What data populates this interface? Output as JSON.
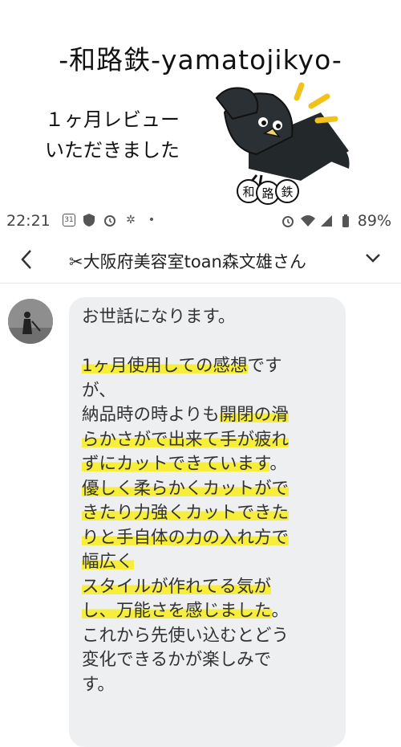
{
  "banner": {
    "brand": "-和路鉄-yamatojikyo-",
    "caption_line1": "１ヶ月レビュー",
    "caption_line2": "いただきました",
    "mascot_label": "和路鉄"
  },
  "status_bar": {
    "time": "22:21",
    "calendar_day": "31",
    "battery_percent": "89%",
    "icons_left": [
      "calendar-icon",
      "shield-icon",
      "alarm-icon",
      "fan-icon",
      "dot-icon"
    ],
    "icons_right": [
      "alarm-icon",
      "wifi-icon",
      "signal-icon",
      "battery-icon"
    ]
  },
  "chat_header": {
    "title": "✂大阪府美容室toan森文雄さん",
    "back_icon": "chevron-left-icon",
    "menu_icon": "chevron-down-icon"
  },
  "message": {
    "segments": [
      {
        "t": "お世話になります。\n\n",
        "h": false
      },
      {
        "t": "1ヶ月使用しての感想",
        "h": true
      },
      {
        "t": "です\nが、\n納品時の時よりも",
        "h": false
      },
      {
        "t": "開閉の滑\nらかさがで出来て手が疲れ\nずにカットできています",
        "h": true
      },
      {
        "t": "。\n",
        "h": false
      },
      {
        "t": "優しく柔らかくカットがで\nきたり力強くカットできた\nりと手自体の力の入れ方で\n幅広く",
        "h": true
      },
      {
        "t": "\n",
        "h": false
      },
      {
        "t": "スタイルが作れてる気が\nし、万能さを感じました",
        "h": true
      },
      {
        "t": "。\nこれから先使い込むとどう\n変化できるかが楽しみで\nす。",
        "h": false
      }
    ]
  },
  "colors": {
    "highlight": "#f7ee3c",
    "bubble": "#eeeff1",
    "text": "#333333"
  }
}
